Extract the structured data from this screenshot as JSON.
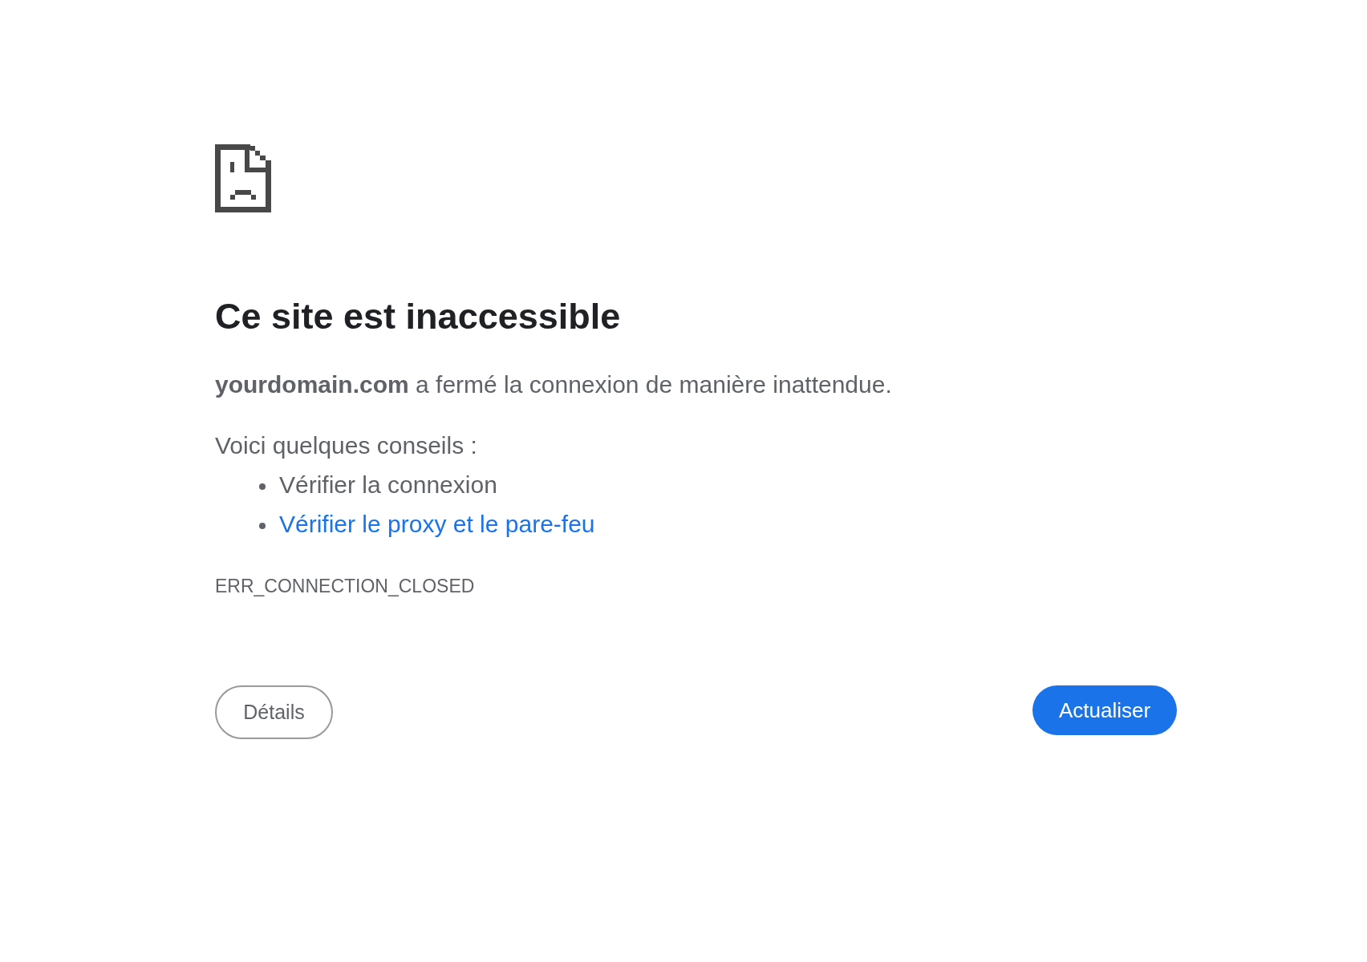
{
  "title": "Ce site est inaccessible",
  "message": "**yourdomain.com** a fermé la connexion de manière inattendue.",
  "suggestions": {
    "heading": "Voici quelques conseils :",
    "items": [
      {
        "kind": "text",
        "text": "Vérifier la connexion"
      },
      {
        "kind": "link",
        "text": "Vérifier le proxy et le pare-feu"
      }
    ]
  },
  "error_code": "ERR_CONNECTION_CLOSED",
  "buttons": [
    {
      "kind": "secondary",
      "label": "Détails"
    },
    {
      "kind": "primary",
      "label": "Actualiser"
    }
  ]
}
